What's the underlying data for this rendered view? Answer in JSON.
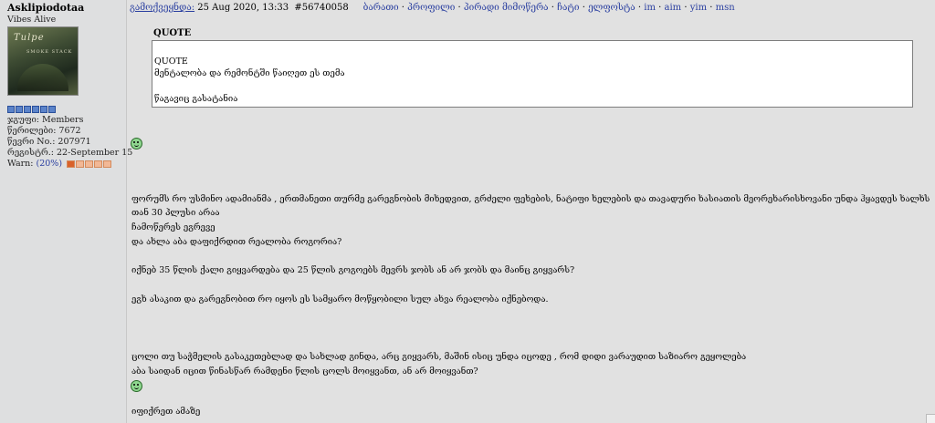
{
  "user": {
    "name": "Asklipiodotaa",
    "title": "Vibes Alive",
    "avatar_text": "Tulpe",
    "avatar_caption": "SMOKE STACK",
    "rank_pips": 6,
    "group_line": "ჯგუფი: Members",
    "posts_line": "წერილები: 7672",
    "member_no_line": "წევრი No.: 207971",
    "registered_line": "რეგისტრ.: 22-September 15",
    "warn_label": "Warn:",
    "warn_value": "(20%)",
    "warn_level": 0.2
  },
  "post": {
    "posted_label": "გამოქვეყნდა:",
    "date": "25 Aug 2020, 13:33",
    "post_id": "#56740058",
    "links": [
      "ბარათი",
      "პროფილი",
      "პირადი მიმოწერა",
      "ჩატი",
      "ელფოსტა",
      "im",
      "aim",
      "yim",
      "msn"
    ],
    "separator": "·",
    "quote": {
      "title": "QUOTE",
      "inner_title": "QUOTE",
      "inner_text": "მენტალობა და რემონტში წაიღეთ ეს თემა",
      "text": "წაგავიც გასატანია"
    },
    "lines": [
      "ფორუმს რო უსმინო ადამიანმა , ერთმანეთი თურმე გარეგნობის მიხედვით, გრძელი ფეხების, ნატიფი ხელების და თავადური ხასიათის მეორეხარისხოვანი უნდა ჰყავდეს ხალხს",
      "თან 30 პლუსი არაა",
      "ჩამოწერეს ეგრევე",
      "და ახლა აბა დაფიქრდით რეალობა როგორია?",
      "იქნებ 35 წლის ქალი გიყვარდება და 25 წლის გოგოებს მევრს ჯობს ან არ ჯობს და მაინც გიყვარს?",
      "ეგხ ასაკით და გარეგნობით რო იყოს ეს სამყარო მოწყობილი სულ ახვა რეალობა იქნებოდა.",
      "ცოლი თუ საჭმელის გასაკეთებლად და სახლად გინდა, არც გიყვარს, მაშინ ისიც უნდა იცოდე , რომ დიდი ვარაუდით საზიარო გეყოლება",
      "აბა საიდან იცით წინასწარ რამდენი წლის ცოლს მოიყვანთ, ან არ მოიყვანთ?",
      "იფიქრეთ ამაზე"
    ]
  }
}
